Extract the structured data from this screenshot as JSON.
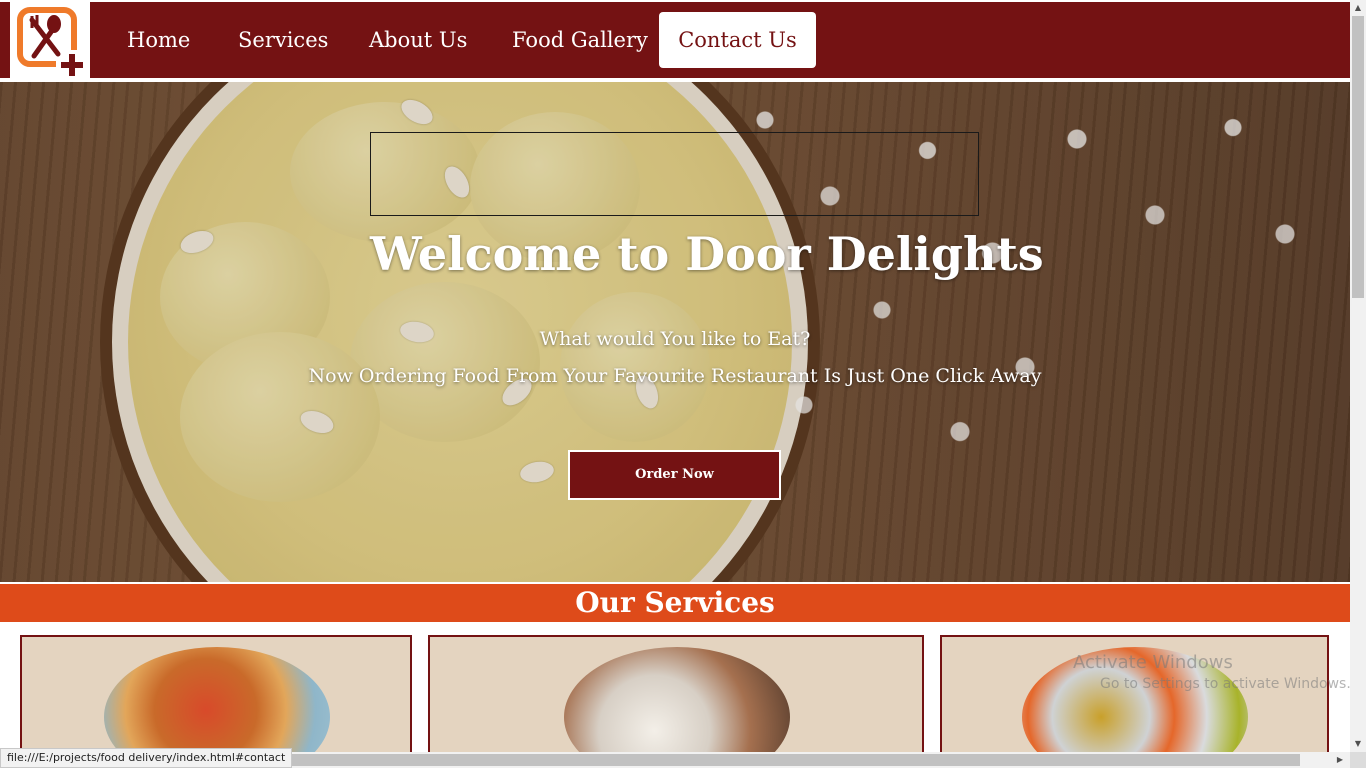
{
  "brand": {
    "primary": "#741213",
    "accent": "#de4b1a",
    "card_bg": "#e4d4c0",
    "logo_icon": "fork-spoon-plus-icon"
  },
  "nav": {
    "home": "Home",
    "services": "Services",
    "about": "About Us",
    "gallery": "Food Gallery",
    "contact": "Contact Us",
    "active": "Contact Us"
  },
  "hero": {
    "title": "Welcome to Door Delights",
    "subtitle_1": "What would You like to Eat?",
    "subtitle_2": "Now Ordering Food From Your Favourite Restaurant Is Just One Click Away",
    "button": "Order Now"
  },
  "services": {
    "title": "Our Services",
    "cards": [
      {
        "image": "pizza-photo"
      },
      {
        "image": "catering-buffet-photo"
      },
      {
        "image": "indian-dishes-photo"
      }
    ]
  },
  "os": {
    "watermark_line1": "Activate Windows",
    "watermark_line2": "Go to Settings to activate Windows.",
    "status_url": "file:///E:/projects/food delivery/index.html#contact"
  }
}
